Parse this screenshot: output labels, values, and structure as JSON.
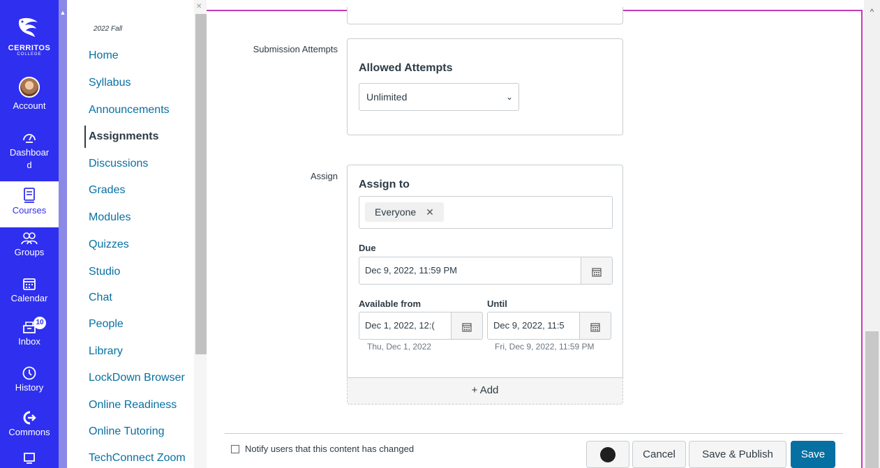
{
  "global_nav": {
    "logo_text": "CERRITOS",
    "logo_sub": "COLLEGE",
    "items": [
      {
        "label": "Account",
        "icon": "avatar"
      },
      {
        "label": "Dashboard",
        "icon": "dashboard-icon"
      },
      {
        "label": "Courses",
        "icon": "courses-icon"
      },
      {
        "label": "Groups",
        "icon": "groups-icon"
      },
      {
        "label": "Calendar",
        "icon": "calendar-icon"
      },
      {
        "label": "Inbox",
        "icon": "inbox-icon",
        "badge": "10"
      },
      {
        "label": "History",
        "icon": "history-icon"
      },
      {
        "label": "Commons",
        "icon": "commons-icon"
      }
    ],
    "colors": {
      "background": "#2f2ff0",
      "active_text": "#2f2ff0"
    }
  },
  "course_nav": {
    "term": "2022 Fall",
    "links": [
      "Home",
      "Syllabus",
      "Announcements",
      "Assignments",
      "Discussions",
      "Grades",
      "Modules",
      "Quizzes",
      "Studio",
      "Chat",
      "People",
      "Library",
      "LockDown Browser",
      "Online Readiness",
      "Online Tutoring",
      "TechConnect Zoom"
    ],
    "active": "Assignments",
    "link_color": "#0770a3"
  },
  "submission": {
    "row_label": "Submission Attempts",
    "title": "Allowed Attempts",
    "selected": "Unlimited"
  },
  "assign": {
    "row_label": "Assign",
    "title": "Assign to",
    "chip": "Everyone",
    "due_label": "Due",
    "due_value": "Dec 9, 2022, 11:59 PM",
    "available_label": "Available from",
    "available_value": "Dec 1, 2022, 12:(",
    "available_hint": "Thu, Dec 1, 2022",
    "until_label": "Until",
    "until_value": "Dec 9, 2022, 11:5",
    "until_hint": "Fri, Dec 9, 2022, 11:59 PM",
    "add_label": "+ Add"
  },
  "footer": {
    "notify_label": "Notify users that this content has changed",
    "cancel": "Cancel",
    "save_publish": "Save & Publish",
    "save": "Save",
    "accent": "#0770a3"
  }
}
